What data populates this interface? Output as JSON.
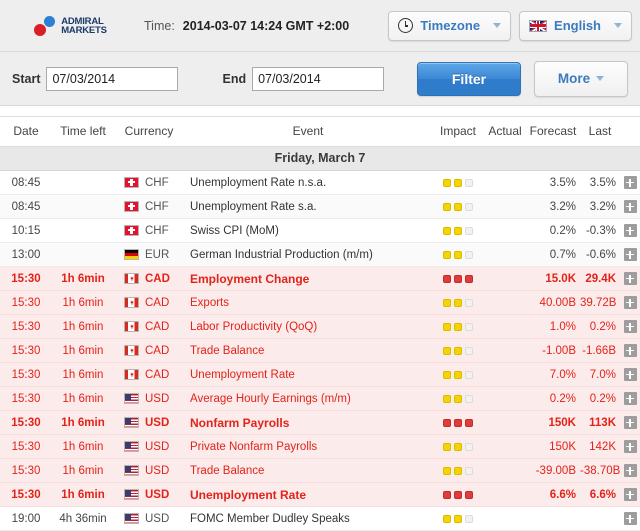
{
  "header": {
    "logo_line1": "ADMIRAL",
    "logo_line2": "MARKETS",
    "time_label": "Time:",
    "time_value": "2014-03-07 14:24 GMT +2:00",
    "timezone_button": "Timezone",
    "language_button": "English"
  },
  "filters": {
    "start_label": "Start",
    "start_value": "07/03/2014",
    "end_label": "End",
    "end_value": "07/03/2014",
    "filter_button": "Filter",
    "more_button": "More"
  },
  "table": {
    "columns": {
      "date": "Date",
      "time_left": "Time left",
      "currency": "Currency",
      "event": "Event",
      "impact": "Impact",
      "actual": "Actual",
      "forecast": "Forecast",
      "last": "Last"
    },
    "day_group": "Friday, March 7",
    "rows": [
      {
        "date": "08:45",
        "time_left": "",
        "flag": "chf",
        "currency": "CHF",
        "event": "Unemployment Rate n.s.a.",
        "impact": "low",
        "actual": "",
        "forecast": "3.5%",
        "last": "3.5%",
        "highlight": false,
        "bold": false
      },
      {
        "date": "08:45",
        "time_left": "",
        "flag": "chf",
        "currency": "CHF",
        "event": "Unemployment Rate s.a.",
        "impact": "low",
        "actual": "",
        "forecast": "3.2%",
        "last": "3.2%",
        "highlight": false,
        "bold": false
      },
      {
        "date": "10:15",
        "time_left": "",
        "flag": "chf",
        "currency": "CHF",
        "event": "Swiss CPI (MoM)",
        "impact": "low",
        "actual": "",
        "forecast": "0.2%",
        "last": "-0.3%",
        "highlight": false,
        "bold": false
      },
      {
        "date": "13:00",
        "time_left": "",
        "flag": "eur",
        "currency": "EUR",
        "event": "German Industrial Production (m/m)",
        "impact": "low",
        "actual": "",
        "forecast": "0.7%",
        "last": "-0.6%",
        "highlight": false,
        "bold": false
      },
      {
        "date": "15:30",
        "time_left": "1h 6min",
        "flag": "cad",
        "currency": "CAD",
        "event": "Employment Change",
        "impact": "high",
        "actual": "",
        "forecast": "15.0K",
        "last": "29.4K",
        "highlight": true,
        "bold": true
      },
      {
        "date": "15:30",
        "time_left": "1h 6min",
        "flag": "cad",
        "currency": "CAD",
        "event": "Exports",
        "impact": "low",
        "actual": "",
        "forecast": "40.00B",
        "last": "39.72B",
        "highlight": true,
        "bold": false
      },
      {
        "date": "15:30",
        "time_left": "1h 6min",
        "flag": "cad",
        "currency": "CAD",
        "event": "Labor Productivity (QoQ)",
        "impact": "low",
        "actual": "",
        "forecast": "1.0%",
        "last": "0.2%",
        "highlight": true,
        "bold": false
      },
      {
        "date": "15:30",
        "time_left": "1h 6min",
        "flag": "cad",
        "currency": "CAD",
        "event": "Trade Balance",
        "impact": "low",
        "actual": "",
        "forecast": "-1.00B",
        "last": "-1.66B",
        "highlight": true,
        "bold": false
      },
      {
        "date": "15:30",
        "time_left": "1h 6min",
        "flag": "cad",
        "currency": "CAD",
        "event": "Unemployment Rate",
        "impact": "low",
        "actual": "",
        "forecast": "7.0%",
        "last": "7.0%",
        "highlight": true,
        "bold": false
      },
      {
        "date": "15:30",
        "time_left": "1h 6min",
        "flag": "usd",
        "currency": "USD",
        "event": "Average Hourly Earnings (m/m)",
        "impact": "low",
        "actual": "",
        "forecast": "0.2%",
        "last": "0.2%",
        "highlight": true,
        "bold": false
      },
      {
        "date": "15:30",
        "time_left": "1h 6min",
        "flag": "usd",
        "currency": "USD",
        "event": "Nonfarm Payrolls",
        "impact": "high",
        "actual": "",
        "forecast": "150K",
        "last": "113K",
        "highlight": true,
        "bold": true
      },
      {
        "date": "15:30",
        "time_left": "1h 6min",
        "flag": "usd",
        "currency": "USD",
        "event": "Private Nonfarm Payrolls",
        "impact": "low",
        "actual": "",
        "forecast": "150K",
        "last": "142K",
        "highlight": true,
        "bold": false
      },
      {
        "date": "15:30",
        "time_left": "1h 6min",
        "flag": "usd",
        "currency": "USD",
        "event": "Trade Balance",
        "impact": "low",
        "actual": "",
        "forecast": "-39.00B",
        "last": "-38.70B",
        "highlight": true,
        "bold": false
      },
      {
        "date": "15:30",
        "time_left": "1h 6min",
        "flag": "usd",
        "currency": "USD",
        "event": "Unemployment Rate",
        "impact": "high",
        "actual": "",
        "forecast": "6.6%",
        "last": "6.6%",
        "highlight": true,
        "bold": true
      },
      {
        "date": "19:00",
        "time_left": "4h 36min",
        "flag": "usd",
        "currency": "USD",
        "event": "FOMC Member Dudley Speaks",
        "impact": "low",
        "actual": "",
        "forecast": "",
        "last": "",
        "highlight": false,
        "bold": false
      }
    ]
  },
  "colors": {
    "accent_blue": "#3a7bbf",
    "highlight_red": "#e2231a",
    "impact_low": "#f5d400",
    "impact_high": "#e03c3c"
  }
}
